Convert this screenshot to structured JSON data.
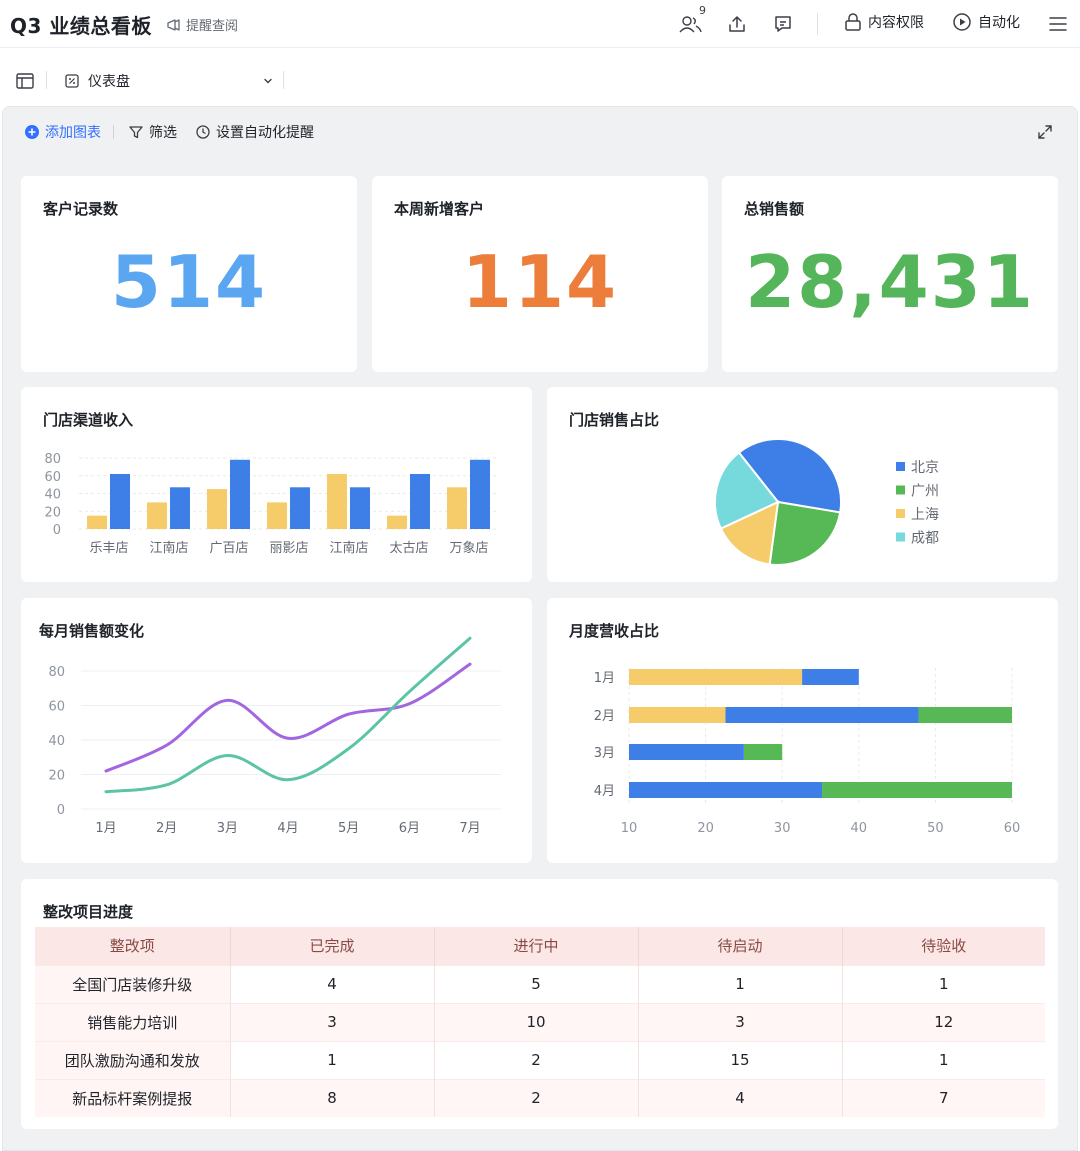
{
  "header": {
    "title": "Q3 业绩总看板",
    "subscribe_label": "提醒查阅",
    "collab_count": "9",
    "permission_label": "内容权限",
    "automation_label": "自动化"
  },
  "view": {
    "selected": "仪表盘"
  },
  "toolbar": {
    "add_chart": "添加图表",
    "filter": "筛选",
    "auto_remind": "设置自动化提醒"
  },
  "kpis": [
    {
      "title": "客户记录数",
      "value": "514",
      "color": "#5aa6f0"
    },
    {
      "title": "本周新增客户",
      "value": "114",
      "color": "#ec7d3b"
    },
    {
      "title": "总销售额",
      "value": "28,431",
      "color": "#55b55a"
    }
  ],
  "colors": {
    "blue": "#3d7fe6",
    "yellow": "#f6cb6a",
    "green": "#57b955",
    "cyan": "#76d9dc",
    "purple": "#a266e0",
    "teal": "#5bc4a6"
  },
  "charts": {
    "store_revenue_title": "门店渠道收入",
    "store_share_title": "门店销售占比",
    "monthly_sales_title": "每月销售额变化",
    "monthly_revenue_title": "月度营收占比"
  },
  "chart_data": [
    {
      "type": "bar",
      "title": "门店渠道收入",
      "categories": [
        "乐丰店",
        "江南店",
        "广百店",
        "丽影店",
        "江南店",
        "太古店",
        "万象店"
      ],
      "series": [
        {
          "values": [
            15,
            30,
            45,
            30,
            62,
            15,
            47
          ]
        },
        {
          "values": [
            62,
            47,
            78,
            47,
            47,
            62,
            78
          ]
        }
      ],
      "ylim": [
        0,
        80
      ],
      "yticks": [
        0,
        20,
        40,
        60,
        80
      ]
    },
    {
      "type": "pie",
      "title": "门店销售占比",
      "legend_position": "right",
      "slices": [
        {
          "name": "北京",
          "value": 36
        },
        {
          "name": "广州",
          "value": 23
        },
        {
          "name": "上海",
          "value": 15
        },
        {
          "name": "成都",
          "value": 20
        }
      ]
    },
    {
      "type": "line",
      "title": "每月销售额变化",
      "categories": [
        "1月",
        "2月",
        "3月",
        "4月",
        "5月",
        "6月",
        "7月"
      ],
      "series": [
        {
          "values": [
            22,
            37,
            63,
            41,
            55,
            61,
            84
          ]
        },
        {
          "values": [
            10,
            14,
            31,
            17,
            35,
            68,
            99
          ]
        }
      ],
      "ylim": [
        0,
        90
      ],
      "yticks": [
        0,
        20,
        40,
        60,
        80
      ]
    },
    {
      "type": "bar",
      "orientation": "horizontal",
      "stacked": true,
      "title": "月度营收占比",
      "categories": [
        "1月",
        "2月",
        "3月",
        "4月"
      ],
      "series": [
        {
          "start": [
            10,
            10,
            null,
            null
          ],
          "end": [
            32.6,
            22.6,
            null,
            null
          ]
        },
        {
          "start": [
            32.6,
            22.6,
            10,
            10
          ],
          "end": [
            40,
            47.8,
            25,
            35.2
          ]
        },
        {
          "start": [
            null,
            47.8,
            25,
            35.2
          ],
          "end": [
            null,
            60,
            30,
            60
          ]
        }
      ],
      "xlim": [
        10,
        60
      ],
      "xticks": [
        10,
        20,
        30,
        40,
        50,
        60
      ]
    }
  ],
  "table": {
    "title": "整改项目进度",
    "headers": [
      "整改项",
      "已完成",
      "进行中",
      "待启动",
      "待验收"
    ],
    "rows": [
      [
        "全国门店装修升级",
        "4",
        "5",
        "1",
        "1"
      ],
      [
        "销售能力培训",
        "3",
        "10",
        "3",
        "12"
      ],
      [
        "团队激励沟通和发放",
        "1",
        "2",
        "15",
        "1"
      ],
      [
        "新品标杆案例提报",
        "8",
        "2",
        "4",
        "7"
      ]
    ]
  }
}
